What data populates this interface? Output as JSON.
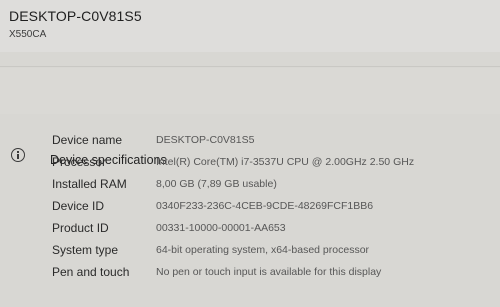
{
  "header": {
    "device_name": "DESKTOP-C0V81S5",
    "model": "X550CA"
  },
  "device_specifications": {
    "title": "Device specifications",
    "icon": "info-icon",
    "rows": [
      {
        "label": "Device name",
        "value": "DESKTOP-C0V81S5"
      },
      {
        "label": "Processor",
        "value": "Intel(R) Core(TM) i7-3537U CPU @ 2.00GHz   2.50 GHz"
      },
      {
        "label": "Installed RAM",
        "value": "8,00 GB (7,89 GB usable)"
      },
      {
        "label": "Device ID",
        "value": "0340F233-236C-4CEB-9CDE-48269FCF1BB6"
      },
      {
        "label": "Product ID",
        "value": "00331-10000-00001-AA653"
      },
      {
        "label": "System type",
        "value": "64-bit operating system, x64-based processor"
      },
      {
        "label": "Pen and touch",
        "value": "No pen or touch input is available for this display"
      }
    ]
  }
}
